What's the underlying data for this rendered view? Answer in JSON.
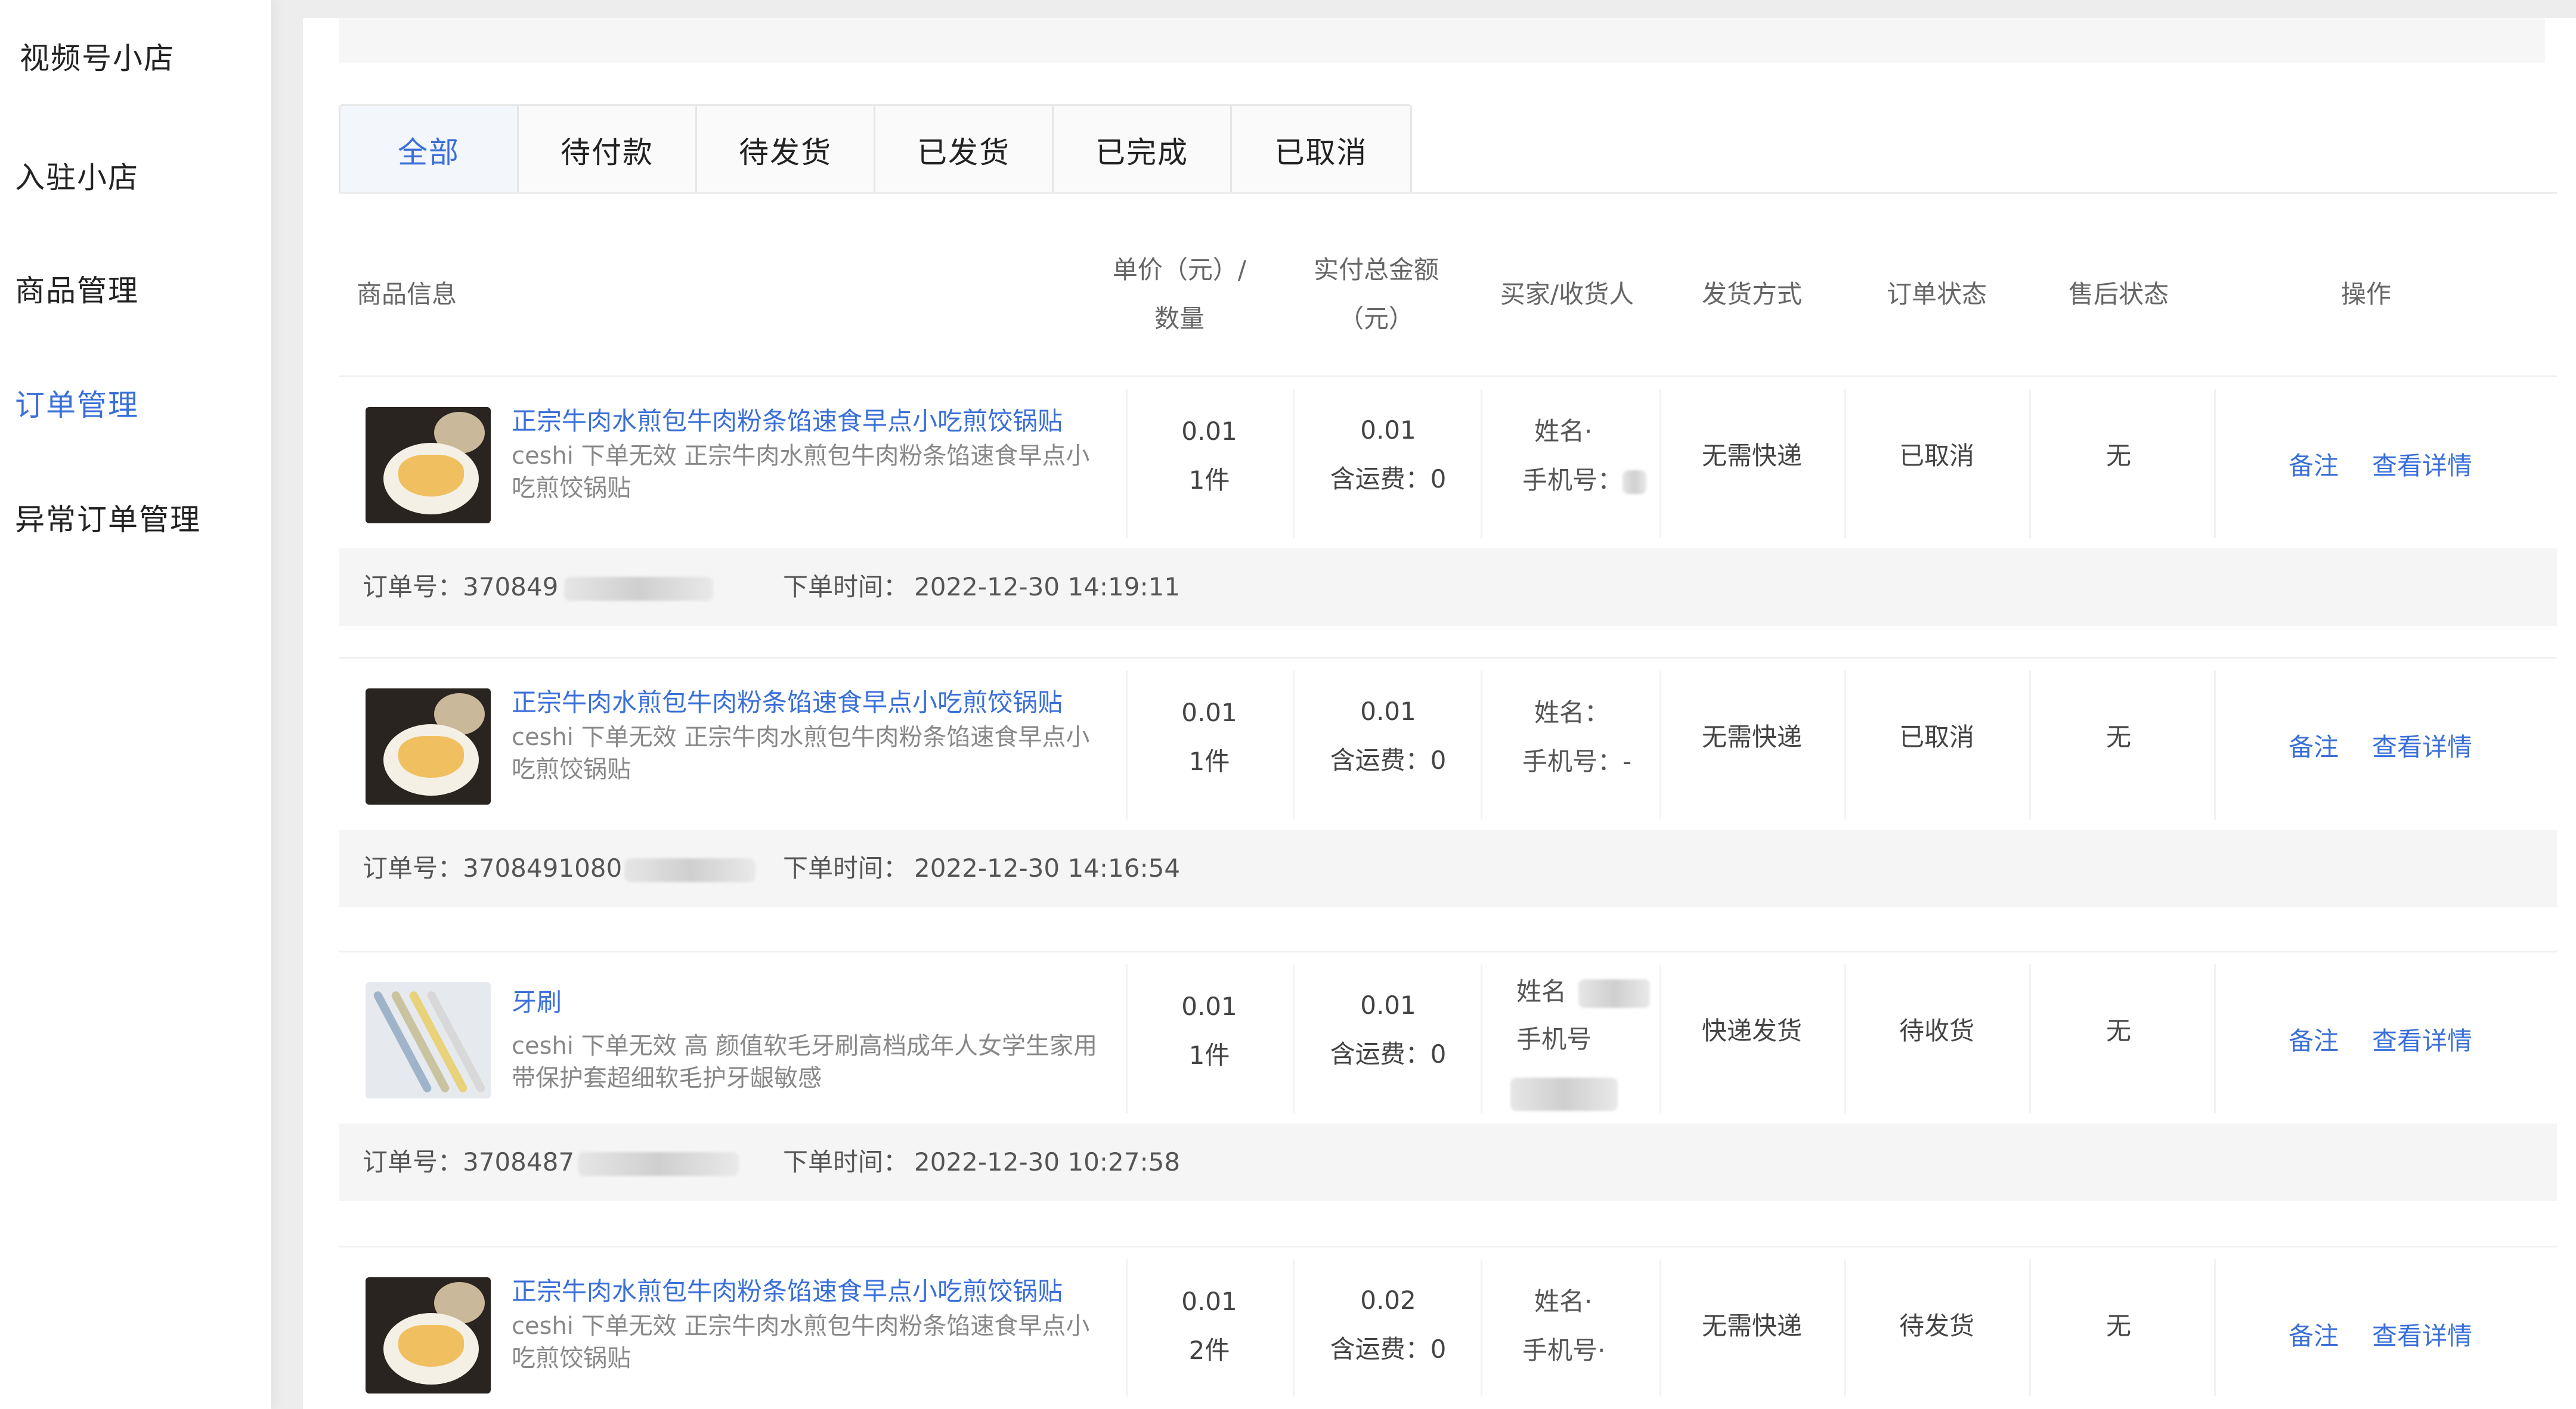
{
  "sidebar": {
    "brand": "视频号小店",
    "items": [
      {
        "label": "入驻小店",
        "active": false
      },
      {
        "label": "商品管理",
        "active": false
      },
      {
        "label": "订单管理",
        "active": true
      },
      {
        "label": "异常订单管理",
        "active": false
      }
    ]
  },
  "tabs": [
    {
      "label": "全部",
      "active": true
    },
    {
      "label": "待付款",
      "active": false
    },
    {
      "label": "待发货",
      "active": false
    },
    {
      "label": "已发货",
      "active": false
    },
    {
      "label": "已完成",
      "active": false
    },
    {
      "label": "已取消",
      "active": false
    }
  ],
  "table_header": {
    "product_info": "商品信息",
    "unit_price_line1": "单价（元）/",
    "unit_price_line2": "数量",
    "total_line1": "实付总金额",
    "total_line2": "（元）",
    "buyer": "买家/收货人",
    "shipping": "发货方式",
    "order_status": "订单状态",
    "after_sale": "售后状态",
    "actions": "操作"
  },
  "orders": [
    {
      "title": "正宗牛肉水煎包牛肉粉条馅速食早点小吃煎饺锅贴",
      "desc": "ceshi 下单无效 正宗牛肉水煎包牛肉粉条馅速食早点小吃煎饺锅贴",
      "unit_price": "0.01",
      "qty": "1件",
      "total": "0.01",
      "freight": "含运费：0",
      "buyer_name": "姓名·",
      "buyer_phone": "手机号：",
      "shipping": "无需快递",
      "status": "已取消",
      "after_sale": "无",
      "remark": "备注",
      "detail": "查看详情",
      "order_no_label": "订单号：",
      "order_no": "370849",
      "time_label": "下单时间：",
      "time": "2022-12-30 14:19:11"
    },
    {
      "title": "正宗牛肉水煎包牛肉粉条馅速食早点小吃煎饺锅贴",
      "desc": "ceshi 下单无效 正宗牛肉水煎包牛肉粉条馅速食早点小吃煎饺锅贴",
      "unit_price": "0.01",
      "qty": "1件",
      "total": "0.01",
      "freight": "含运费：0",
      "buyer_name": "姓名：",
      "buyer_phone": "手机号：-",
      "shipping": "无需快递",
      "status": "已取消",
      "after_sale": "无",
      "remark": "备注",
      "detail": "查看详情",
      "order_no_label": "订单号：",
      "order_no": "3708491080",
      "time_label": "下单时间：",
      "time": "2022-12-30 14:16:54"
    },
    {
      "title": "牙刷",
      "desc": "ceshi 下单无效 高 颜值软毛牙刷高档成年人女学生家用带保护套超细软毛护牙龈敏感",
      "unit_price": "0.01",
      "qty": "1件",
      "total": "0.01",
      "freight": "含运费：0",
      "buyer_name": "姓名",
      "buyer_phone": "手机号",
      "shipping": "快递发货",
      "status": "待收货",
      "after_sale": "无",
      "remark": "备注",
      "detail": "查看详情",
      "order_no_label": "订单号：",
      "order_no": "3708487",
      "time_label": "下单时间：",
      "time": "2022-12-30 10:27:58"
    },
    {
      "title": "正宗牛肉水煎包牛肉粉条馅速食早点小吃煎饺锅贴",
      "desc": "ceshi 下单无效 正宗牛肉水煎包牛肉粉条馅速食早点小吃煎饺锅贴",
      "unit_price": "0.01",
      "qty": "2件",
      "total": "0.02",
      "freight": "含运费：0",
      "buyer_name": "姓名·",
      "buyer_phone": "手机号·",
      "shipping": "无需快递",
      "status": "待发货",
      "after_sale": "无",
      "remark": "备注",
      "detail": "查看详情"
    }
  ],
  "colors": {
    "accent": "#3a6fd8",
    "meta_bg": "#f5f5f5"
  }
}
